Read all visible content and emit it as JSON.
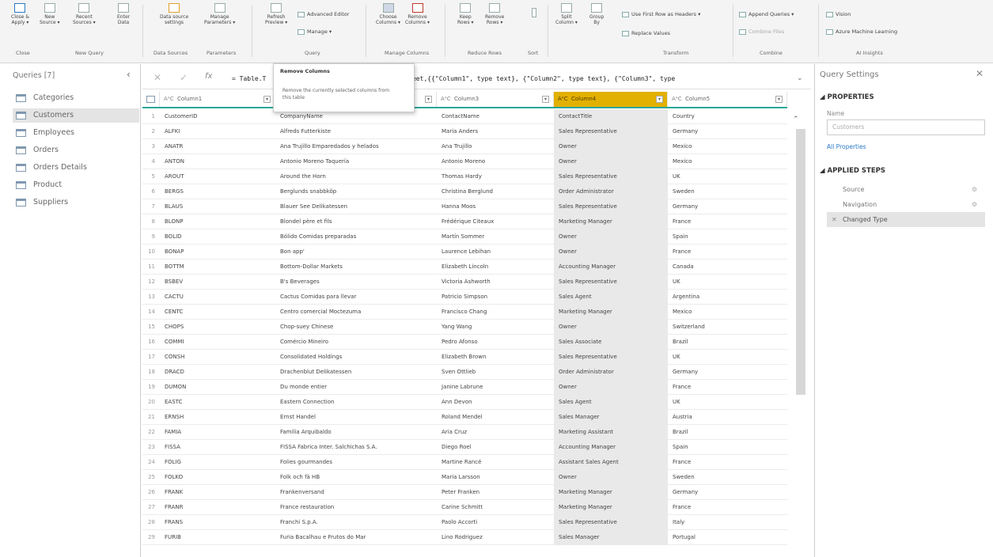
{
  "ribbon": {
    "buttons": [
      {
        "label": "Close &\nApply ▾"
      },
      {
        "label": "New\nSource ▾"
      },
      {
        "label": "Recent\nSources ▾"
      },
      {
        "label": "Enter\nData"
      },
      {
        "label": "Data source\nsettings"
      },
      {
        "label": "Manage\nParameters ▾"
      },
      {
        "label": "Refresh\nPreview ▾"
      },
      {
        "label": "Choose\nColumns ▾"
      },
      {
        "label": "Remove\nColumns ▾"
      },
      {
        "label": "Keep\nRows ▾"
      },
      {
        "label": "Remove\nRows ▾"
      },
      {
        "label": "Split\nColumn ▾"
      },
      {
        "label": "Group\nBy"
      }
    ],
    "small": {
      "advanced_editor": "Advanced Editor",
      "manage": "Manage ▾",
      "use_first_row": "Use First Row as Headers ▾",
      "replace_values": "Replace Values",
      "append_queries": "Append Queries ▾",
      "combine_files": "Combine Files",
      "vision": "Vision",
      "azure_ml": "Azure Machine Learning"
    },
    "groups": [
      "Close",
      "New Query",
      "Data Sources",
      "Parameters",
      "Query",
      "Manage Columns",
      "Reduce Rows",
      "Sort",
      "Transform",
      "Combine",
      "AI Insights"
    ]
  },
  "queries": {
    "header": "Queries [7]",
    "items": [
      "Categories",
      "Customers",
      "Employees",
      "Orders",
      "Orders Details",
      "Product",
      "Suppliers"
    ],
    "selected_index": 1
  },
  "formula_bar": {
    "prefix": "= Table.T",
    "text": "Sheet,{{\"Column1\", type text}, {\"Column2\", type text}, {\"Column3\", type"
  },
  "tooltip": {
    "title": "Remove Columns",
    "description": "Remove the currently selected columns from this table"
  },
  "grid": {
    "columns": [
      {
        "name": "Column1",
        "highlighted": false
      },
      {
        "name": "",
        "highlighted": false
      },
      {
        "name": "Column3",
        "highlighted": false
      },
      {
        "name": "Column4",
        "highlighted": true
      },
      {
        "name": "Column5",
        "highlighted": false
      }
    ],
    "type_glyph": "AᴬC",
    "rows": [
      [
        "CustomerID",
        "CompanyName",
        "ContactName",
        "ContactTitle",
        "Country"
      ],
      [
        "ALFKI",
        "Alfreds Futterkiste",
        "Maria Anders",
        "Sales Representative",
        "Germany"
      ],
      [
        "ANATR",
        "Ana Trujillo Emparedados y helados",
        "Ana Trujillo",
        "Owner",
        "Mexico"
      ],
      [
        "ANTON",
        "Antonio Moreno Taquería",
        "Antonio Moreno",
        "Owner",
        "Mexico"
      ],
      [
        "AROUT",
        "Around the Horn",
        "Thomas Hardy",
        "Sales Representative",
        "UK"
      ],
      [
        "BERGS",
        "Berglunds snabbköp",
        "Christina Berglund",
        "Order Administrator",
        "Sweden"
      ],
      [
        "BLAUS",
        "Blauer See Delikatessen",
        "Hanna Moos",
        "Sales Representative",
        "Germany"
      ],
      [
        "BLONP",
        "Blondel père et fils",
        "Frédérique Citeaux",
        "Marketing Manager",
        "France"
      ],
      [
        "BOLID",
        "Bólido Comidas preparadas",
        "Martín Sommer",
        "Owner",
        "Spain"
      ],
      [
        "BONAP",
        "Bon app'",
        "Laurence Lebihan",
        "Owner",
        "France"
      ],
      [
        "BOTTM",
        "Bottom-Dollar Markets",
        "Elizabeth Lincoln",
        "Accounting Manager",
        "Canada"
      ],
      [
        "BSBEV",
        "B's Beverages",
        "Victoria Ashworth",
        "Sales Representative",
        "UK"
      ],
      [
        "CACTU",
        "Cactus Comidas para llevar",
        "Patricio Simpson",
        "Sales Agent",
        "Argentina"
      ],
      [
        "CENTC",
        "Centro comercial Moctezuma",
        "Francisco Chang",
        "Marketing Manager",
        "Mexico"
      ],
      [
        "CHOPS",
        "Chop-suey Chinese",
        "Yang Wang",
        "Owner",
        "Switzerland"
      ],
      [
        "COMMI",
        "Comércio Mineiro",
        "Pedro Afonso",
        "Sales Associate",
        "Brazil"
      ],
      [
        "CONSH",
        "Consolidated Holdings",
        "Elizabeth Brown",
        "Sales Representative",
        "UK"
      ],
      [
        "DRACD",
        "Drachenblut Delikatessen",
        "Sven Ottlieb",
        "Order Administrator",
        "Germany"
      ],
      [
        "DUMON",
        "Du monde entier",
        "Janine Labrune",
        "Owner",
        "France"
      ],
      [
        "EASTC",
        "Eastern Connection",
        "Ann Devon",
        "Sales Agent",
        "UK"
      ],
      [
        "ERNSH",
        "Ernst Handel",
        "Roland Mendel",
        "Sales Manager",
        "Austria"
      ],
      [
        "FAMIA",
        "Familia Arquibaldo",
        "Aria Cruz",
        "Marketing Assistant",
        "Brazil"
      ],
      [
        "FISSA",
        "FISSA Fabrica Inter. Salchichas S.A.",
        "Diego Roel",
        "Accounting Manager",
        "Spain"
      ],
      [
        "FOLIG",
        "Folies gourmandes",
        "Martine Rancé",
        "Assistant Sales Agent",
        "France"
      ],
      [
        "FOLKO",
        "Folk och fä HB",
        "Maria Larsson",
        "Owner",
        "Sweden"
      ],
      [
        "FRANK",
        "Frankenversand",
        "Peter Franken",
        "Marketing Manager",
        "Germany"
      ],
      [
        "FRANR",
        "France restauration",
        "Carine Schmitt",
        "Marketing Manager",
        "France"
      ],
      [
        "FRANS",
        "Franchi S.p.A.",
        "Paolo Accorti",
        "Sales Representative",
        "Italy"
      ],
      [
        "FURIB",
        "Furia Bacalhau e Frutos do Mar",
        "Lino Rodriguez",
        "Sales Manager",
        "Portugal"
      ]
    ]
  },
  "settings": {
    "title": "Query Settings",
    "properties_header": "◢ PROPERTIES",
    "name_label": "Name",
    "name_value": "Customers",
    "all_properties": "All Properties",
    "applied_steps_header": "◢ APPLIED STEPS",
    "steps": [
      "Source",
      "Navigation",
      "Changed Type"
    ]
  },
  "colors": {
    "accent": "#2aa79a",
    "highlight_column": "#e2b000",
    "link": "#2b79c8"
  }
}
